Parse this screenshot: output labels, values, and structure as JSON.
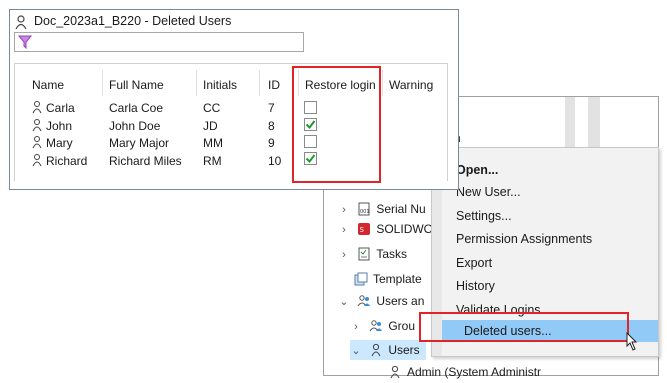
{
  "dialog": {
    "title": "Doc_2023a1_B220 - Deleted Users",
    "filter_value": "",
    "columns": [
      "Name",
      "Full Name",
      "Initials",
      "ID",
      "Restore login",
      "Warning"
    ],
    "rows": [
      {
        "name": "Carla",
        "full_name": "Carla Coe",
        "initials": "CC",
        "id": "7",
        "restore": false
      },
      {
        "name": "John",
        "full_name": "John Doe",
        "initials": "JD",
        "id": "8",
        "restore": true
      },
      {
        "name": "Mary",
        "full_name": "Mary Major",
        "initials": "MM",
        "id": "9",
        "restore": false
      },
      {
        "name": "Richard",
        "full_name": "Richard Miles",
        "initials": "RM",
        "id": "10",
        "restore": true
      }
    ]
  },
  "explorer": {
    "partial_top_text": "em",
    "tree": [
      {
        "label": "Serial Nu",
        "icon": "serial-number-icon",
        "expander": "collapsed"
      },
      {
        "label": "SOLIDWO",
        "icon": "solidworks-icon",
        "expander": "collapsed"
      },
      {
        "label": "Tasks",
        "icon": "tasks-icon",
        "expander": "collapsed"
      },
      {
        "label": "Template",
        "icon": "template-icon",
        "expander": "none"
      },
      {
        "label": "Users an",
        "icon": "users-groups-icon",
        "expander": "expanded"
      },
      {
        "label": "Grou",
        "icon": "groups-icon",
        "expander": "collapsed"
      },
      {
        "label": "Users",
        "icon": "user-icon",
        "expander": "expanded"
      },
      {
        "label": "Admin (System Administr",
        "icon": "user-icon",
        "expander": "none"
      }
    ]
  },
  "context_menu": {
    "items": [
      {
        "label": "Open...",
        "bold": true
      },
      {
        "label": "New User..."
      },
      {
        "label": "Settings..."
      },
      {
        "label": "Permission Assignments"
      },
      {
        "label": "Export"
      },
      {
        "label": "History"
      },
      {
        "label": "Validate Logins"
      },
      {
        "label": "Deleted users...",
        "hover": true
      }
    ]
  },
  "colors": {
    "highlight": "#e0242a",
    "menu_hover": "#91c9f7",
    "check_green": "#1e9a2e",
    "filter_icon": "#9a3fbf"
  }
}
